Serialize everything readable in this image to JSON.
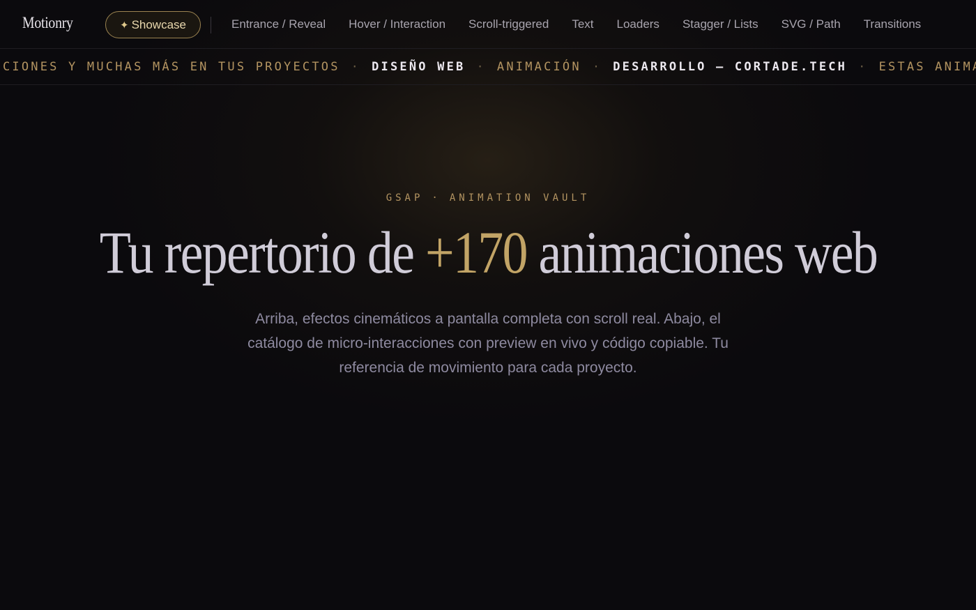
{
  "nav": {
    "brand": "Motionry",
    "showcase_icon": "✦",
    "showcase_label": "Showcase",
    "links": [
      "Entrance / Reveal",
      "Hover / Interaction",
      "Scroll-triggered",
      "Text",
      "Loaders",
      "Stagger / Lists",
      "SVG / Path",
      "Transitions"
    ]
  },
  "marquee": {
    "separator": "·",
    "items": [
      {
        "text": "CIONES Y MUCHAS MÁS EN TUS PROYECTOS",
        "style": "gold"
      },
      {
        "text": "DISEÑO WEB",
        "style": "white"
      },
      {
        "text": "ANIMACIÓN",
        "style": "gold"
      },
      {
        "text": "DESARROLLO — CORTADE.TECH",
        "style": "white"
      },
      {
        "text": "ESTAS ANIMACIONES",
        "style": "gold"
      }
    ]
  },
  "hero": {
    "eyebrow_left": "GSAP",
    "eyebrow_sep": "·",
    "eyebrow_right": "ANIMATION VAULT",
    "headline_pre": "Tu repertorio de ",
    "headline_accent": "+170",
    "headline_post": " animaciones web",
    "subtitle": "Arriba, efectos cinemáticos a pantalla completa con scroll real. Abajo, el catálogo de micro-interacciones con preview en vivo y código copiable. Tu referencia de movimiento para cada proyecto."
  },
  "colors": {
    "background": "#0b0a0d",
    "accent_gold": "#c2a466",
    "headline": "#d0ccd8",
    "muted": "#8e8aa0"
  }
}
